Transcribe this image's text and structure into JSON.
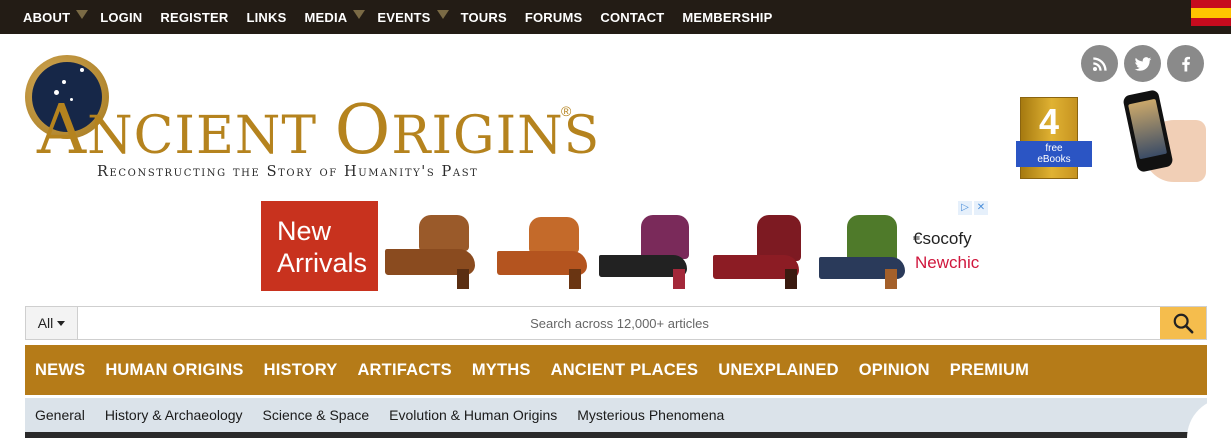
{
  "topnav": {
    "items": [
      {
        "label": "ABOUT",
        "caret": true
      },
      {
        "label": "LOGIN",
        "caret": false
      },
      {
        "label": "REGISTER",
        "caret": false
      },
      {
        "label": "LINKS",
        "caret": false
      },
      {
        "label": "MEDIA",
        "caret": true
      },
      {
        "label": "EVENTS",
        "caret": true
      },
      {
        "label": "TOURS",
        "caret": false
      },
      {
        "label": "FORUMS",
        "caret": false
      },
      {
        "label": "CONTACT",
        "caret": false
      },
      {
        "label": "MEMBERSHIP",
        "caret": false
      }
    ],
    "flag_icon": "spain-flag-icon"
  },
  "logo": {
    "title_first_cap": "A",
    "title_first_rest": "NCIENT ",
    "title_second_cap": "O",
    "title_second_rest": "RIGINS",
    "registered": "®",
    "tagline": "Reconstructing the Story of Humanity's Past",
    "colors": {
      "gold": "#b5831e",
      "navy": "#162748"
    }
  },
  "social": [
    "rss-icon",
    "twitter-icon",
    "facebook-icon"
  ],
  "ebooks": {
    "count": "4",
    "line1": "free",
    "line2": "eBooks"
  },
  "ad": {
    "headline_line1": "New",
    "headline_line2": "Arrivals",
    "brand1": "€socofy",
    "brand2_part1": "New",
    "brand2_part2": "chic",
    "adchoice_play": "▷",
    "adchoice_close": "✕"
  },
  "search": {
    "scope": "All",
    "placeholder": "Search across 12,000+ articles"
  },
  "mainnav": {
    "items": [
      "NEWS",
      "HUMAN ORIGINS",
      "HISTORY",
      "ARTIFACTS",
      "MYTHS",
      "ANCIENT PLACES",
      "UNEXPLAINED",
      "OPINION",
      "PREMIUM"
    ],
    "color": "#b57b18"
  },
  "subnav": {
    "items": [
      "General",
      "History & Archaeology",
      "Science & Space",
      "Evolution & Human Origins",
      "Mysterious Phenomena"
    ]
  }
}
